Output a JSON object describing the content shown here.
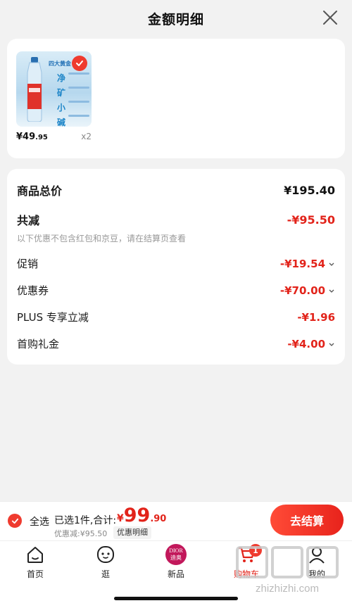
{
  "sheet": {
    "title": "金额明细"
  },
  "product": {
    "thumb_banner": "四大黄金",
    "thumb_chars": [
      "净",
      "矿",
      "小",
      "碱"
    ],
    "price_yuan": "¥",
    "price_int": "49",
    "price_dec": ".95",
    "qty": "x2"
  },
  "summary": {
    "total_label": "商品总价",
    "total_value": "¥195.40",
    "reduce_label": "共减",
    "reduce_value": "-¥95.50",
    "note": "以下优惠不包含红包和京豆，请在结算页查看",
    "rows": [
      {
        "label": "促销",
        "value": "-¥19.54",
        "chevron": true
      },
      {
        "label": "优惠券",
        "value": "-¥70.00",
        "chevron": true
      },
      {
        "label": "PLUS 专享立减",
        "value": "-¥1.96",
        "chevron": false
      },
      {
        "label": "首购礼金",
        "value": "-¥4.00",
        "chevron": true
      }
    ]
  },
  "checkout": {
    "select_all": "全选",
    "selected": "已选1件,合计:",
    "total_yuan": "¥",
    "total_int": "99",
    "total_dec": ".90",
    "discount": "优惠减:¥95.50",
    "detail_tag": "优惠明细",
    "button": "去结算"
  },
  "tabs": [
    {
      "label": "首页",
      "icon": "home-icon"
    },
    {
      "label": "逛",
      "icon": "face-icon"
    },
    {
      "label": "新品",
      "icon": "dior-logo"
    },
    {
      "label": "购物车",
      "icon": "cart-icon",
      "badge": "1"
    },
    {
      "label": "我的",
      "icon": "user-icon"
    }
  ],
  "watermark": {
    "text": "zhizhizhi.com"
  },
  "colors": {
    "accent": "#e2231a",
    "background": "#f2f2f2"
  }
}
